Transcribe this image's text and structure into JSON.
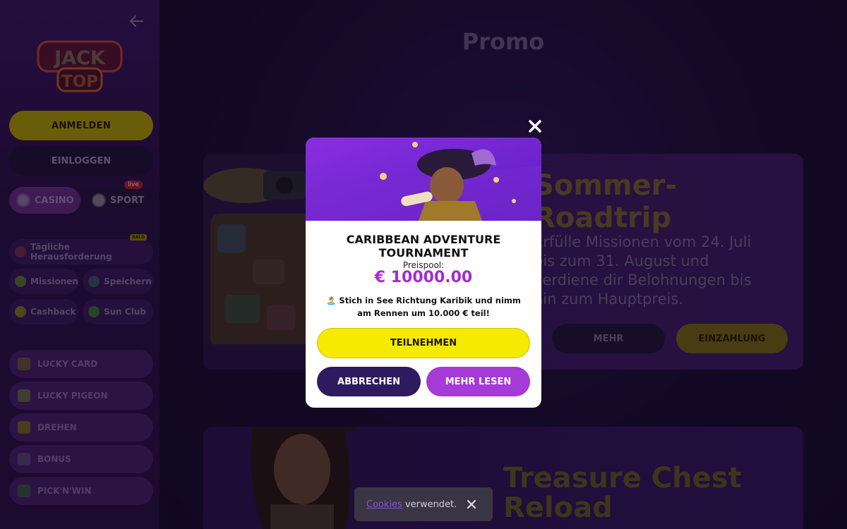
{
  "sidebar": {
    "logo_text": [
      "JACK",
      "TOP"
    ],
    "register_label": "ANMELDEN",
    "login_label": "EINLOGGEN",
    "casino_label": "CASINO",
    "sport_label": "SPORT",
    "live_badge": "live",
    "daily_challenge": "Tägliche Herausforderung",
    "daily_badge": "BALD",
    "missions": "Missionen",
    "save": "Speichern",
    "cashback": "Cashback",
    "sunclub": "Sun Club",
    "items": [
      {
        "label": "LUCKY CARD",
        "icon": "card-icon"
      },
      {
        "label": "LUCKY PIGEON",
        "icon": "pigeon-icon"
      },
      {
        "label": "DREHEN",
        "icon": "spin-icon"
      },
      {
        "label": "BONUS",
        "icon": "gift-icon"
      },
      {
        "label": "PICK'N'WIN",
        "icon": "pick-icon"
      }
    ]
  },
  "main": {
    "title": "Promo",
    "promo1": {
      "title_line1": "Sommer-",
      "title_line2": "Roadtrip",
      "desc": "Erfülle Missionen vom 24. Juli bis zum 31. August und verdiene dir Belohnungen bis hin zum Hauptpreis.",
      "more_label": "MEHR",
      "deposit_label": "EINZAHLUNG"
    },
    "promo2": {
      "title_line1": "Treasure Chest",
      "title_line2": "Reload"
    }
  },
  "modal": {
    "title_line1": "CARIBBEAN ADVENTURE",
    "title_line2": "TOURNAMENT",
    "pool_label": "Preispool:",
    "pool_value": "€ 10000.00",
    "desc_icon": "🏝️",
    "desc": "Stich in See Richtung Karibik und nimm am Rennen um 10.000 € teil!",
    "join_label": "TEILNEHMEN",
    "cancel_label": "ABBRECHEN",
    "read_more_label": "MEHR LESEN"
  },
  "cookie": {
    "link": "Cookies",
    "text": "verwendet."
  },
  "colors": {
    "accent_yellow": "#f6ea00",
    "accent_purple": "#a53ad6",
    "dark_purple": "#2e1a5e",
    "pool_purple": "#a32bd0"
  }
}
